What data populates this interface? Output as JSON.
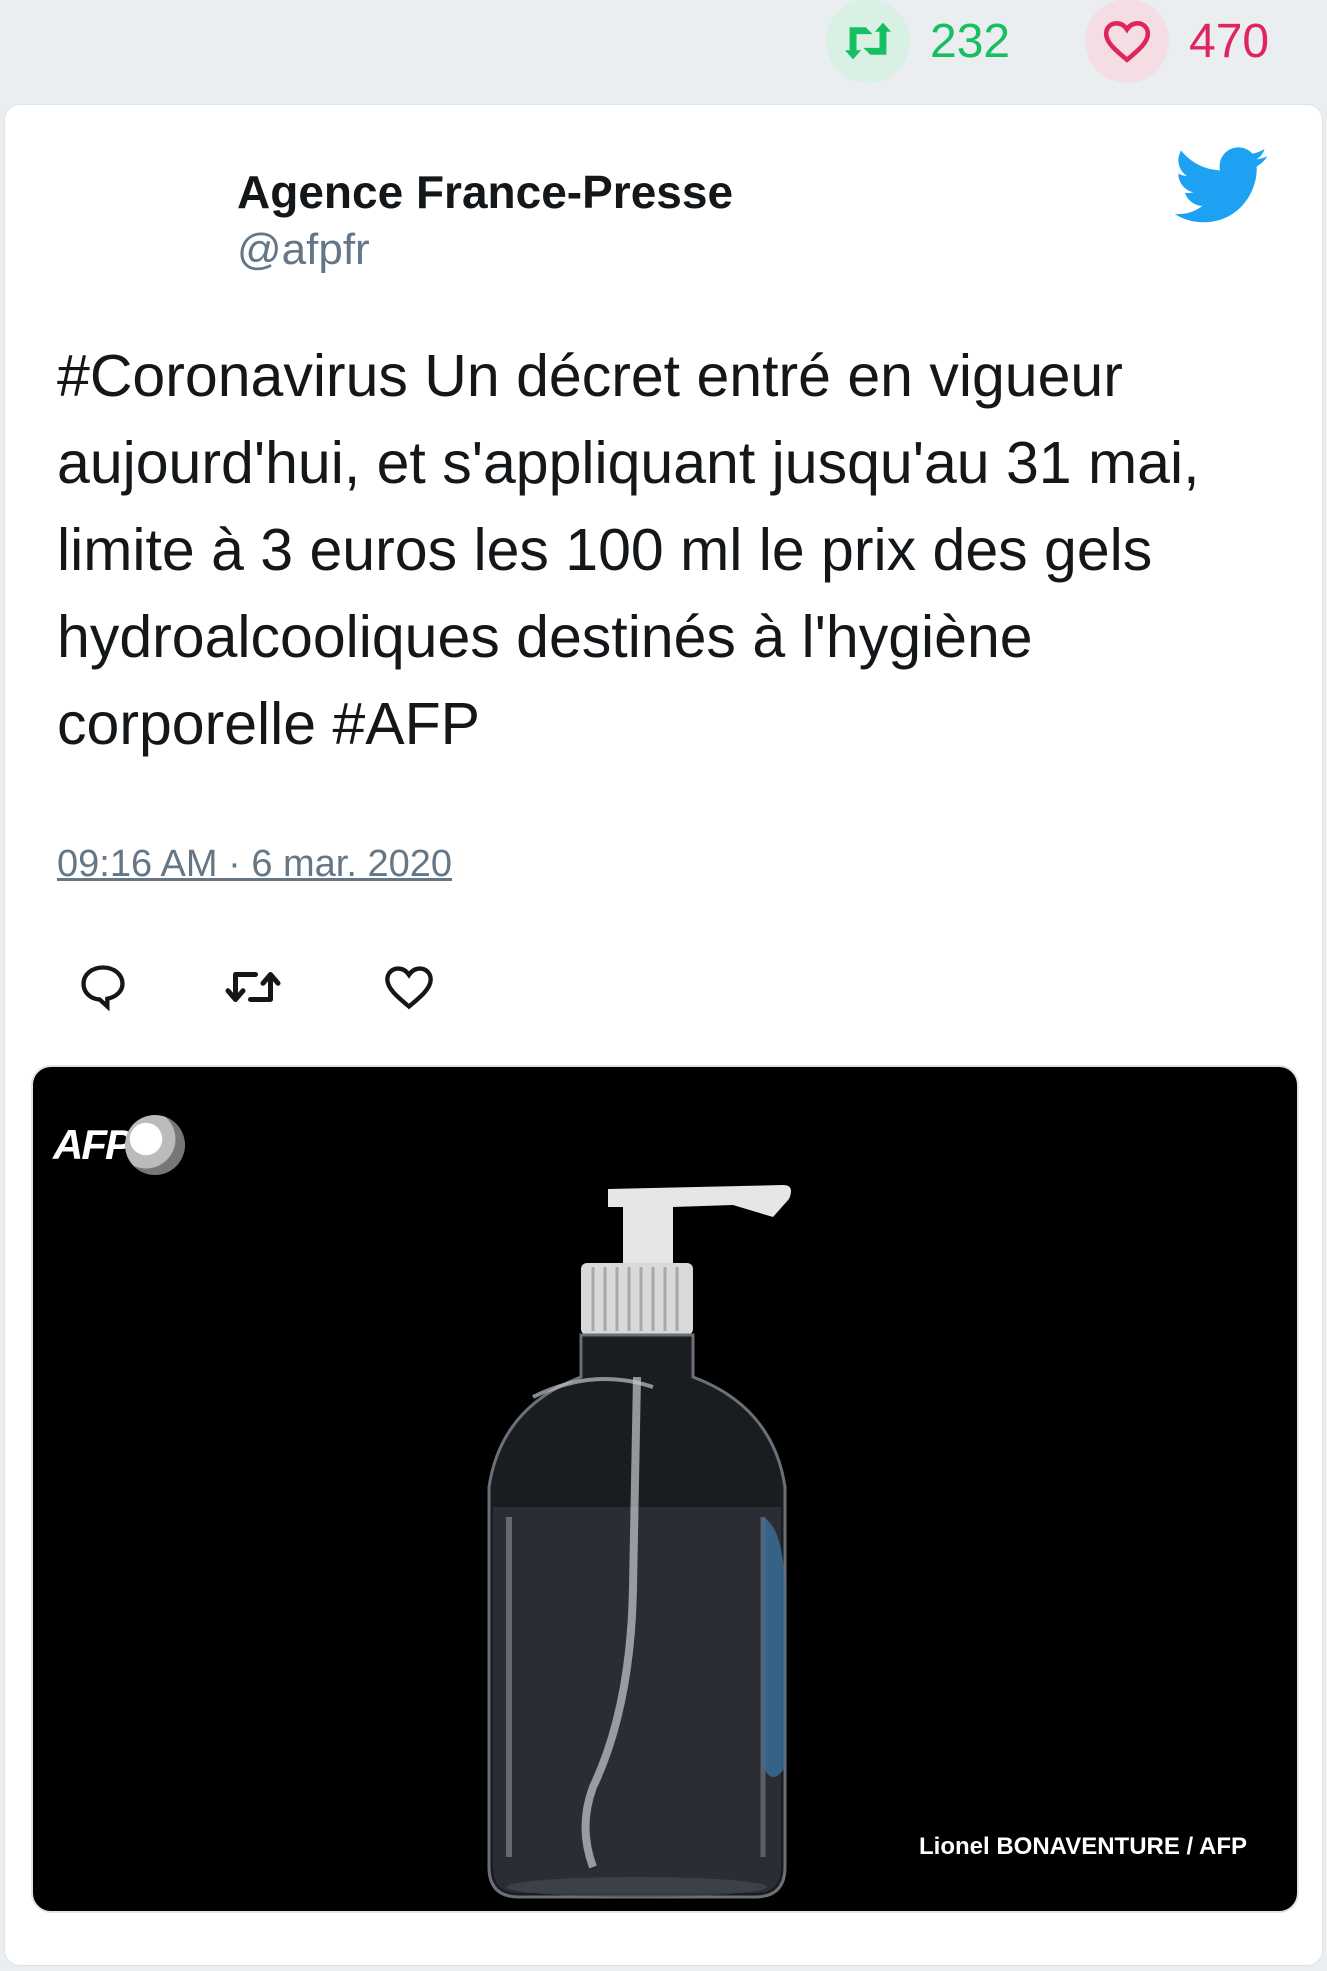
{
  "stats": {
    "retweet_count": "232",
    "like_count": "470",
    "retweet_icon": "retweet-icon",
    "like_icon": "heart-icon",
    "retweet_color": "#17bf63",
    "like_color": "#e0245e"
  },
  "tweet": {
    "display_name": "Agence France-Presse",
    "handle": "@afpfr",
    "text": "#Coronavirus Un décret entré en vigueur aujourd'hui, et s'appliquant jusqu'au 31 mai, limite à 3 euros les 100 ml le prix des gels hydroalcooliques destinés à l'hygiène corporelle #AFP",
    "timestamp": "09:16 AM · 6 mar. 2020",
    "platform_icon": "twitter-bird-icon",
    "brand_color": "#1da1f2"
  },
  "actions": {
    "reply_icon": "reply-icon",
    "retweet_icon": "retweet-icon",
    "like_icon": "heart-icon"
  },
  "media": {
    "logo_text": "AFP",
    "credit": "Lionel BONAVENTURE / AFP"
  }
}
